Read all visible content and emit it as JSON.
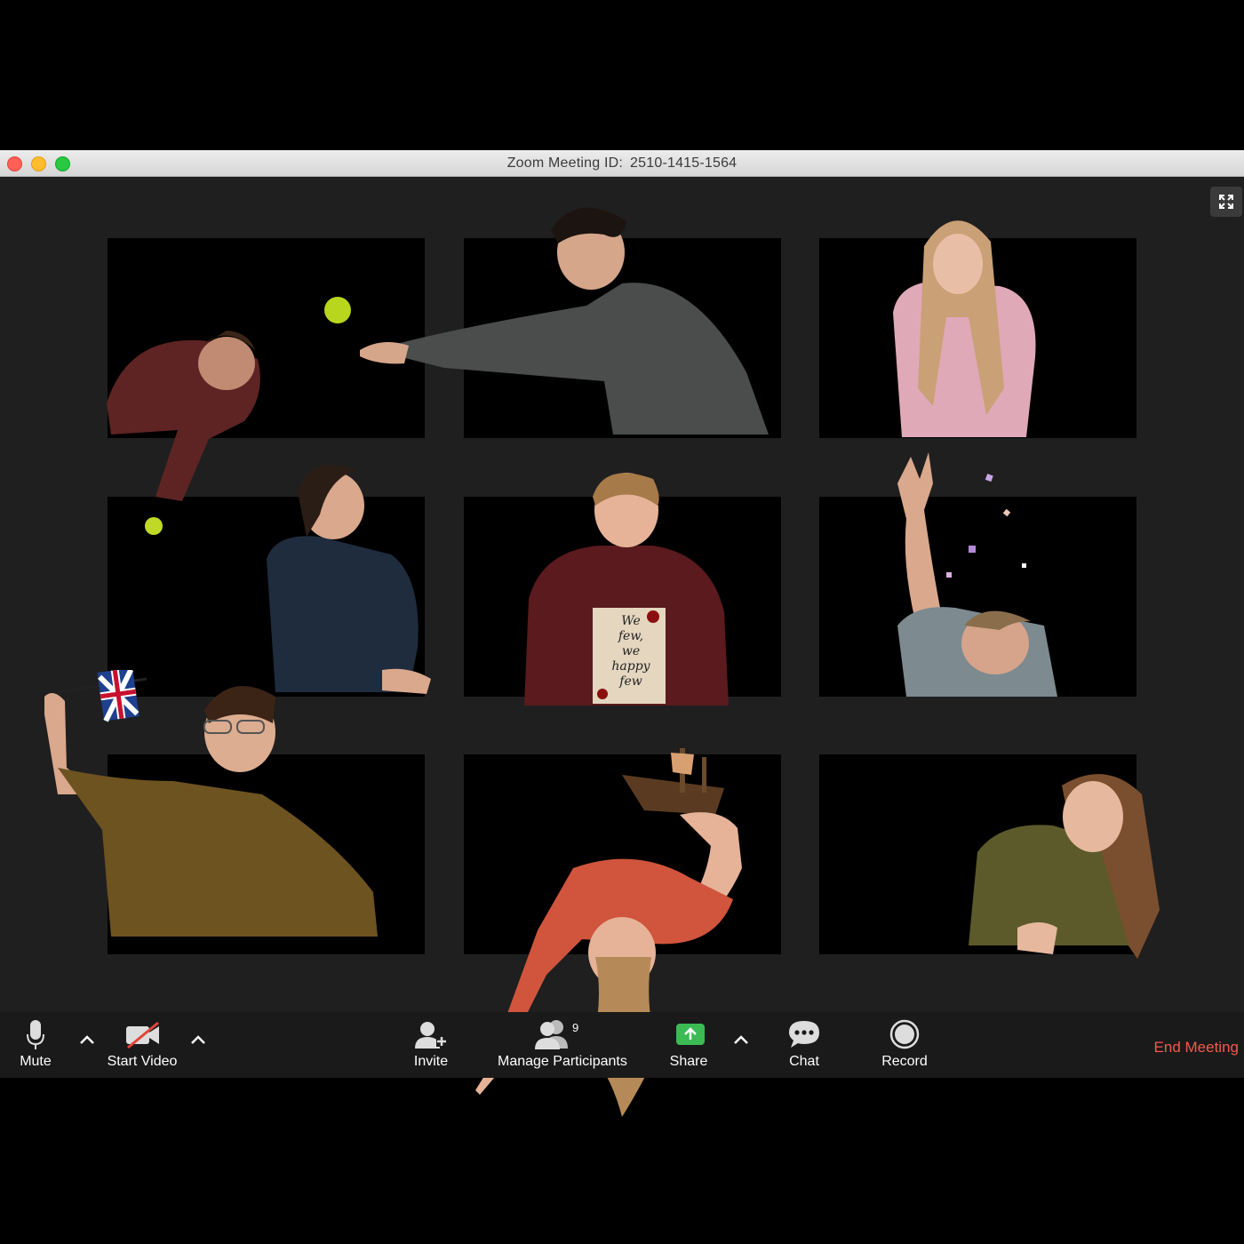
{
  "window": {
    "title_label": "Zoom Meeting ID:",
    "meeting_id": "2510-1415-1564"
  },
  "sign": {
    "text": "We few, we happy few"
  },
  "toolbar": {
    "mute_label": "Mute",
    "start_video_label": "Start Video",
    "invite_label": "Invite",
    "manage_participants_label": "Manage Participants",
    "participant_count": "9",
    "share_label": "Share",
    "chat_label": "Chat",
    "record_label": "Record",
    "end_meeting_label": "End Meeting"
  },
  "colors": {
    "toolbar_bg": "#1a1a1a",
    "end_meeting": "#f25a4b",
    "window_bg": "#1f1f1f"
  }
}
